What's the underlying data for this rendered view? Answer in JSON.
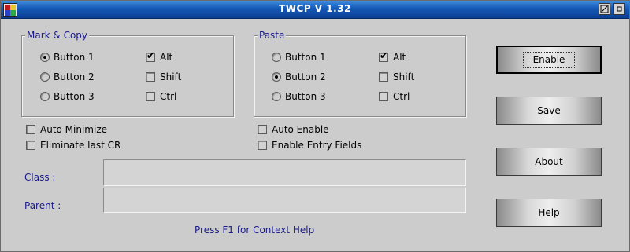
{
  "window": {
    "title": "TWCP V 1.32",
    "icons": {
      "app": "app-icon",
      "minimize": "minimize-icon",
      "restore": "restore-icon"
    }
  },
  "mark_copy": {
    "title": "Mark & Copy",
    "buttons": [
      {
        "label": "Button 1",
        "selected": true
      },
      {
        "label": "Button 2",
        "selected": false
      },
      {
        "label": "Button 3",
        "selected": false
      }
    ],
    "modifiers": [
      {
        "label": "Alt",
        "checked": true
      },
      {
        "label": "Shift",
        "checked": false
      },
      {
        "label": "Ctrl",
        "checked": false
      }
    ]
  },
  "paste": {
    "title": "Paste",
    "buttons": [
      {
        "label": "Button 1",
        "selected": false
      },
      {
        "label": "Button 2",
        "selected": true
      },
      {
        "label": "Button 3",
        "selected": false
      }
    ],
    "modifiers": [
      {
        "label": "Alt",
        "checked": true
      },
      {
        "label": "Shift",
        "checked": false
      },
      {
        "label": "Ctrl",
        "checked": false
      }
    ]
  },
  "options": {
    "auto_minimize": "Auto Minimize",
    "eliminate_last_cr": "Eliminate last CR",
    "auto_enable": "Auto Enable",
    "enable_entry_fields": "Enable Entry Fields"
  },
  "fields": {
    "class_label": "Class :",
    "class_value": "",
    "parent_label": "Parent :",
    "parent_value": ""
  },
  "help": "Press F1 for Context Help",
  "actions": {
    "enable": "Enable",
    "save": "Save",
    "about": "About",
    "help": "Help"
  }
}
